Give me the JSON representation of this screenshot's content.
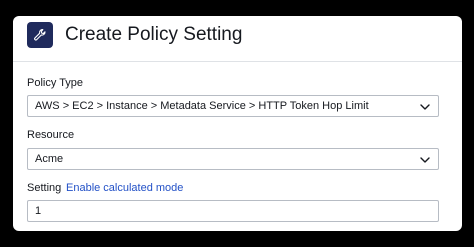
{
  "dialog": {
    "title": "Create Policy Setting",
    "header_icon": "wrench-icon",
    "accent_color": "#1f2a5c",
    "link_color": "#2351c7"
  },
  "policy_type": {
    "label": "Policy Type",
    "value": "AWS > EC2 > Instance > Metadata Service > HTTP Token Hop Limit"
  },
  "resource": {
    "label": "Resource",
    "value": "Acme"
  },
  "setting": {
    "label": "Setting",
    "link": "Enable calculated mode",
    "value": "1"
  }
}
